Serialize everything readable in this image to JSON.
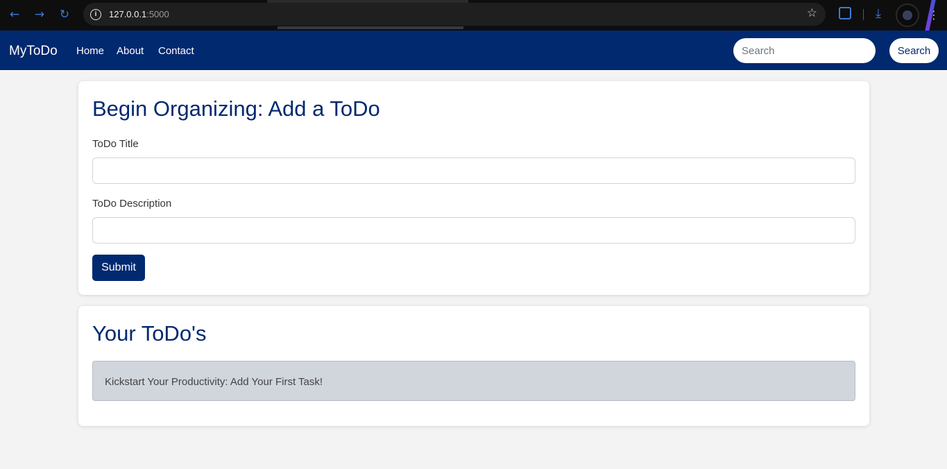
{
  "browser": {
    "url_host": "127.0.0.1",
    "url_port": ":5000"
  },
  "navbar": {
    "brand": "MyToDo",
    "links": [
      "Home",
      "About",
      "Contact"
    ],
    "search_placeholder": "Search",
    "search_button": "Search"
  },
  "add_card": {
    "heading": "Begin Organizing: Add a ToDo",
    "title_label": "ToDo Title",
    "title_value": "",
    "description_label": "ToDo Description",
    "description_value": "",
    "submit_label": "Submit"
  },
  "list_card": {
    "heading": "Your ToDo's",
    "empty_message": "Kickstart Your Productivity: Add Your First Task!"
  },
  "colors": {
    "primary": "#012970",
    "background": "#f3f3f3",
    "empty_alert": "#d1d5dc"
  }
}
